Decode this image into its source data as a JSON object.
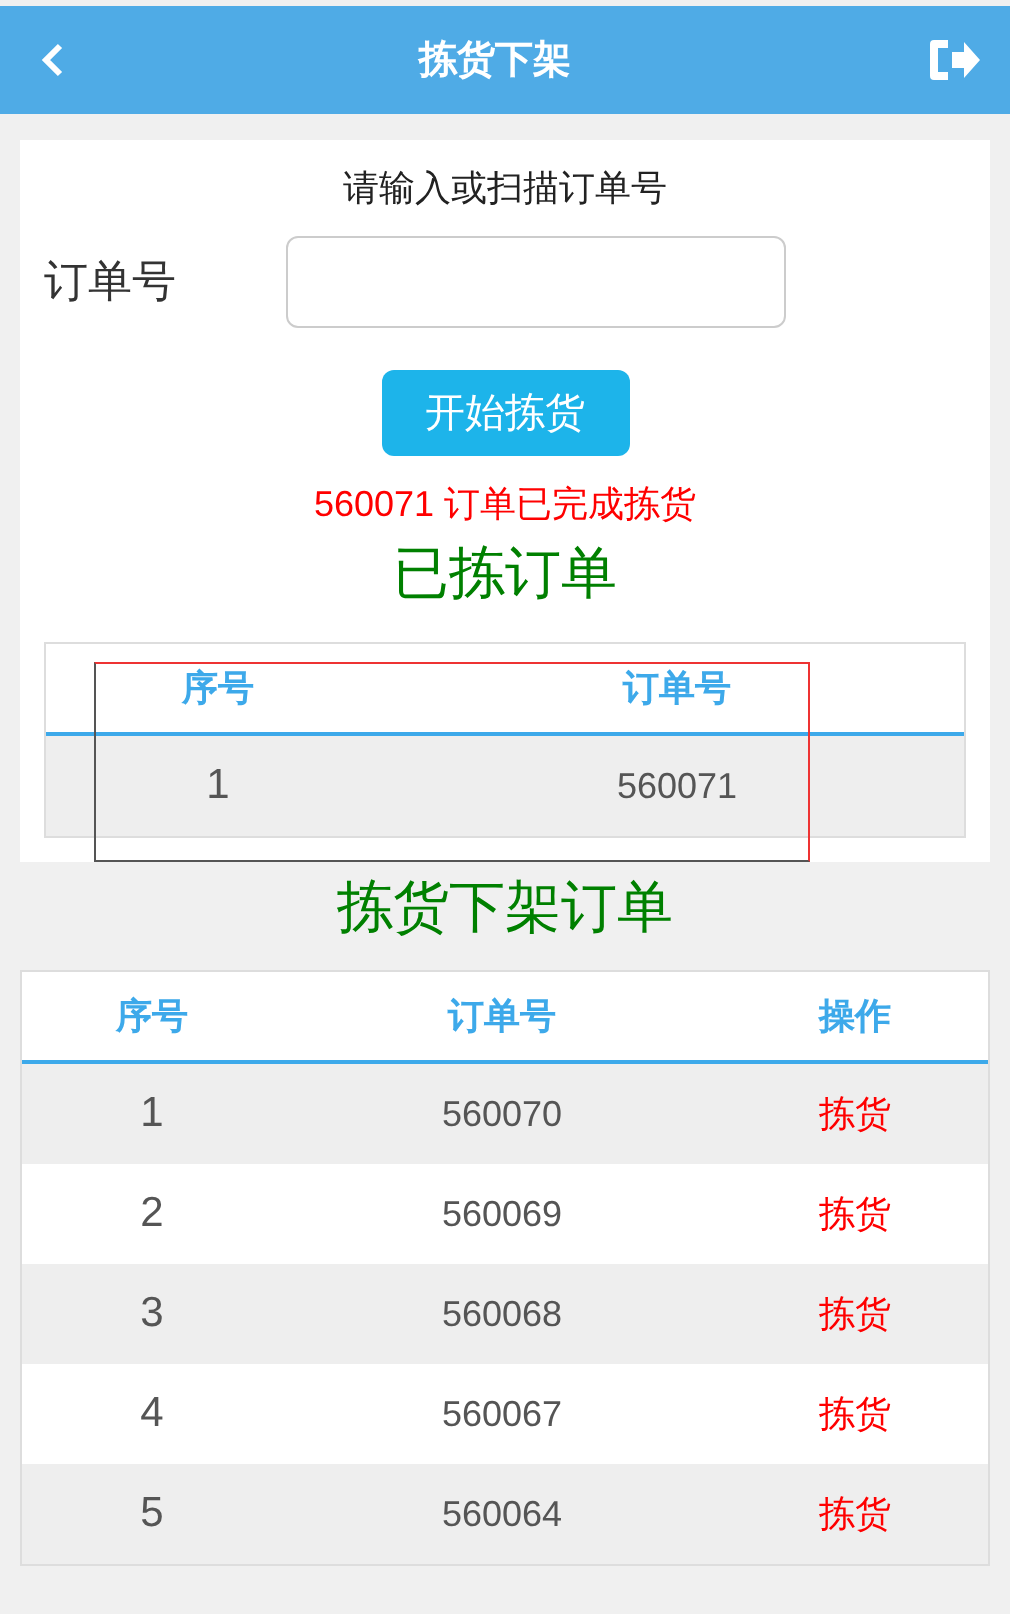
{
  "header": {
    "title": "拣货下架"
  },
  "scan_form": {
    "prompt": "请输入或扫描订单号",
    "field_label": "订单号",
    "button": "开始拣货",
    "message": "560071 订单已完成拣货"
  },
  "picked_orders": {
    "title": "已拣订单",
    "columns": [
      "序号",
      "订单号"
    ],
    "rows": [
      {
        "index": "1",
        "order": "560071"
      }
    ]
  },
  "pick_orders": {
    "title": "拣货下架订单",
    "columns": [
      "序号",
      "订单号",
      "操作"
    ],
    "rows": [
      {
        "index": "1",
        "order": "560070",
        "action": "拣货"
      },
      {
        "index": "2",
        "order": "560069",
        "action": "拣货"
      },
      {
        "index": "3",
        "order": "560068",
        "action": "拣货"
      },
      {
        "index": "4",
        "order": "560067",
        "action": "拣货"
      },
      {
        "index": "5",
        "order": "560064",
        "action": "拣货"
      }
    ]
  }
}
